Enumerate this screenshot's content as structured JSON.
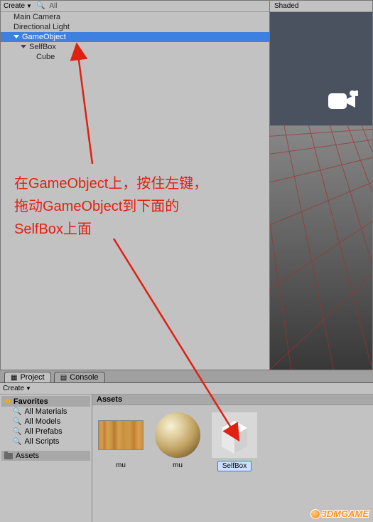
{
  "hierarchy": {
    "create_label": "Create",
    "search_placeholder": "All",
    "items": [
      {
        "label": "Main Camera",
        "level": 1,
        "foldout": false,
        "selected": false
      },
      {
        "label": "Directional Light",
        "level": 1,
        "foldout": false,
        "selected": false
      },
      {
        "label": "GameObject",
        "level": 1,
        "foldout": true,
        "selected": true
      },
      {
        "label": "SelfBox",
        "level": 2,
        "foldout": true,
        "selected": false
      },
      {
        "label": "Cube",
        "level": 3,
        "foldout": false,
        "selected": false
      }
    ]
  },
  "scene": {
    "header_label": "Shaded"
  },
  "tabs": {
    "project": "Project",
    "console": "Console"
  },
  "project": {
    "create_label": "Create",
    "favorites_label": "Favorites",
    "fav_items": [
      {
        "label": "All Materials"
      },
      {
        "label": "All Models"
      },
      {
        "label": "All Prefabs"
      },
      {
        "label": "All Scripts"
      }
    ],
    "assets_folder_label": "Assets",
    "assets_header": "Assets",
    "assets": [
      {
        "label": "mu",
        "kind": "wood",
        "selected": false
      },
      {
        "label": "mu",
        "kind": "sphere",
        "selected": false
      },
      {
        "label": "SelfBox",
        "kind": "cube",
        "selected": true
      }
    ]
  },
  "annotation": {
    "line1": "在GameObject上，按住左键，",
    "line2": "拖动GameObject到下面的",
    "line3": "SelfBox上面"
  },
  "watermark": "3DMGAME"
}
